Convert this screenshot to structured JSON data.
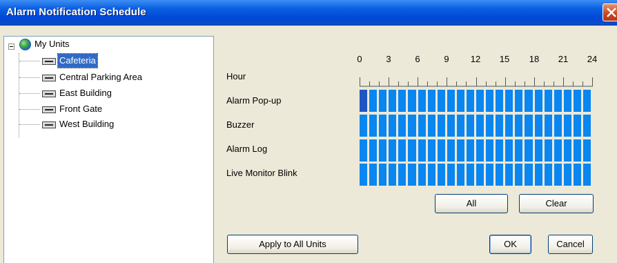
{
  "window": {
    "title": "Alarm Notification Schedule"
  },
  "tree": {
    "root": "My Units",
    "items": [
      {
        "label": "Cafeteria",
        "selected": true
      },
      {
        "label": "Central Parking Area",
        "selected": false
      },
      {
        "label": "East Building",
        "selected": false
      },
      {
        "label": "Front Gate",
        "selected": false
      },
      {
        "label": "West Building",
        "selected": false
      }
    ]
  },
  "schedule": {
    "hour_label": "Hour",
    "hour_ticks": [
      "0",
      "3",
      "6",
      "9",
      "12",
      "15",
      "18",
      "21",
      "24"
    ],
    "rows": [
      {
        "label": "Alarm Pop-up",
        "enabled_hours": 24,
        "highlighted_hour": 0
      },
      {
        "label": "Buzzer",
        "enabled_hours": 24
      },
      {
        "label": "Alarm Log",
        "enabled_hours": 24
      },
      {
        "label": "Live Monitor Blink",
        "enabled_hours": 24
      }
    ],
    "cell_color": "#0A86F1",
    "highlight_color": "#1D56C2"
  },
  "buttons": {
    "all": "All",
    "clear": "Clear",
    "apply_all": "Apply to All Units",
    "ok": "OK",
    "cancel": "Cancel"
  }
}
